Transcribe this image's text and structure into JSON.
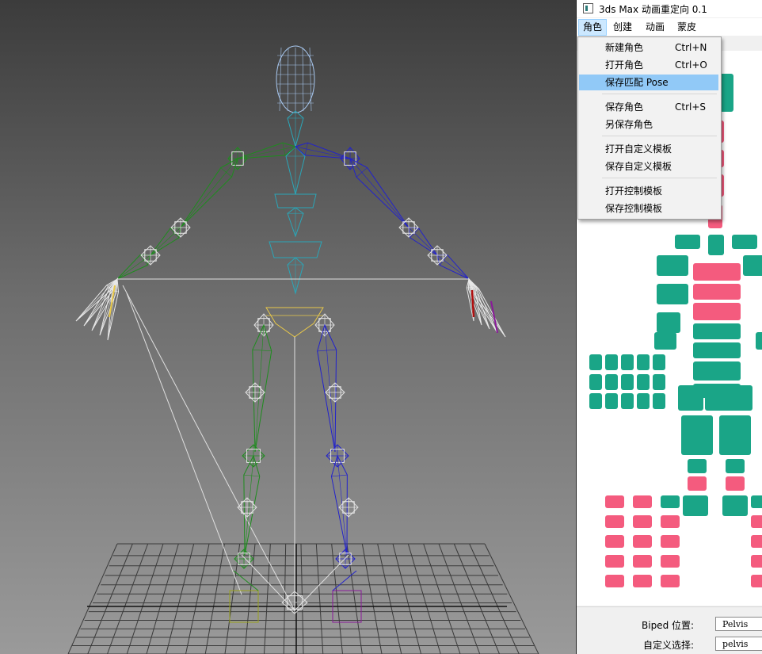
{
  "window": {
    "title": "3ds Max 动画重定向 0.1"
  },
  "menubar": [
    {
      "label": "角色",
      "active": true
    },
    {
      "label": "创建"
    },
    {
      "label": "动画"
    },
    {
      "label": "蒙皮"
    }
  ],
  "menu": {
    "items": [
      {
        "label": "新建角色",
        "shortcut": "Ctrl+N"
      },
      {
        "label": "打开角色",
        "shortcut": "Ctrl+O"
      },
      {
        "label": "保存匹配 Pose",
        "shortcut": "",
        "highlighted": true
      },
      {
        "label": "保存角色",
        "shortcut": "Ctrl+S"
      },
      {
        "label": "另保存角色",
        "shortcut": ""
      },
      {
        "label": "打开自定义模板",
        "shortcut": ""
      },
      {
        "label": "保存自定义模板",
        "shortcut": ""
      },
      {
        "label": "打开控制模板",
        "shortcut": ""
      },
      {
        "label": "保存控制模板",
        "shortcut": ""
      }
    ]
  },
  "fields": {
    "biped_label": "Biped 位置:",
    "biped_value": "Pelvis",
    "custom_label": "自定义选择:",
    "custom_value": "pelvis"
  },
  "colors": {
    "teal": "#1aa587",
    "pink": "#f45b7e",
    "highlight": "#91c9f7",
    "spine": "#2aa6b8",
    "left_limb": "#1e8c1e",
    "right_limb": "#2222cc",
    "head": "#a8c8f0",
    "pelvis": "#e8c84a"
  },
  "icons": {
    "app": "app-window-icon"
  }
}
